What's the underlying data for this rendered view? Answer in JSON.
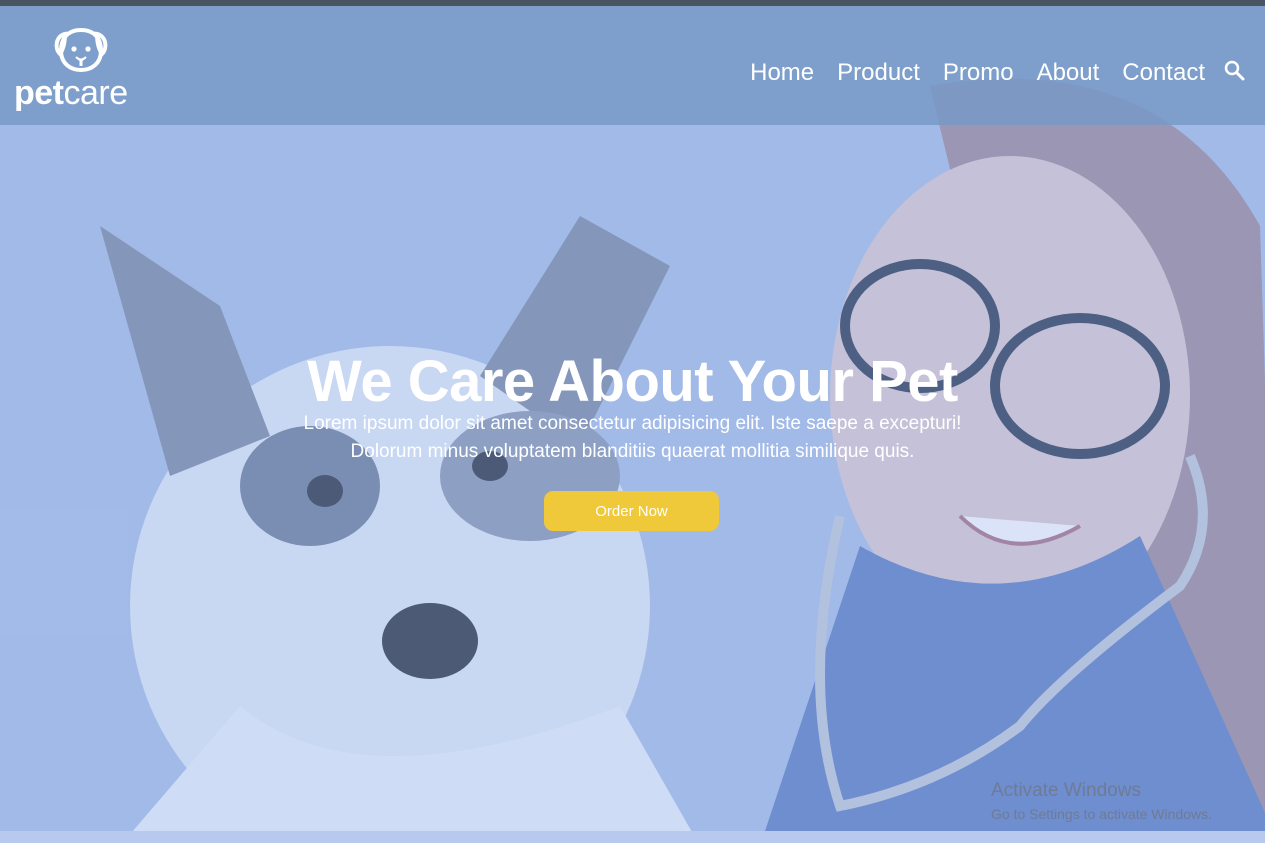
{
  "brand": {
    "bold": "pet",
    "light": "care"
  },
  "nav": {
    "items": [
      "Home",
      "Product",
      "Promo",
      "About",
      "Contact"
    ]
  },
  "hero": {
    "title": "We Care About Your Pet",
    "line1": "Lorem ipsum dolor sit amet consectetur adipisicing elit. Iste saepe a excepturi!",
    "line2": "Dolorum minus voluptatem blanditiis quaerat mollitia similique quis.",
    "button": "Order Now"
  },
  "watermark": {
    "title": "Activate Windows",
    "subtitle": "Go to Settings to activate Windows."
  },
  "icons": {
    "search": "search-icon",
    "logo": "dog-face-icon"
  },
  "colors": {
    "navbar": "#7698c4",
    "hero": "#a8bee8",
    "button": "#f0c93b",
    "text": "#ffffff"
  }
}
